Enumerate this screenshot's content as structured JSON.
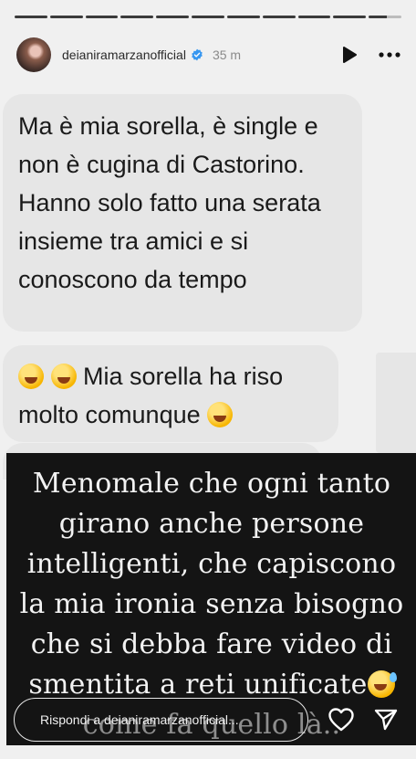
{
  "progress": {
    "segments": 11,
    "current_index": 10
  },
  "header": {
    "username": "deianiramarzanofficial",
    "time_ago": "35 m",
    "verified": true,
    "icons": [
      "play-icon",
      "more-icon"
    ]
  },
  "messages": [
    {
      "text": "Ma è mia sorella, è single e non è cugina di Castorino. Hanno solo fatto una serata insieme tra amici e si conoscono da tempo"
    },
    {
      "text_before": "Mia sorella ha riso molto comunque"
    }
  ],
  "caption": {
    "main": "Menomale che ogni tanto girano anche persone intelligenti, che capiscono la mia ironia senza bisogno che si debba fare video di smentita a reti unificate",
    "tail": "come fa quello là.."
  },
  "reply": {
    "placeholder": "Rispondi a deianiramarzanofficial..."
  },
  "colors": {
    "background": "#f0f0f0",
    "bubble": "#e6e6e6",
    "overlay": "#141414",
    "verified": "#3797f0"
  }
}
